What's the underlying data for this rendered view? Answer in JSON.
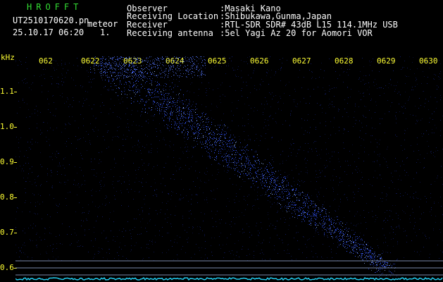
{
  "header": {
    "brand": "HROFFT",
    "filename": "UT2510170620.pn",
    "tag": "meteor",
    "datetime": "25.10.17 06:20",
    "count": "1."
  },
  "station": {
    "observer_label": "Observer",
    "observer_value": ":Masaki Kano",
    "location_label": "Receiving Location",
    "location_value": ":Shibukawa,Gunma,Japan",
    "receiver_label": "Receiver",
    "receiver_value": ":RTL-SDR SDR# 43dB L15 114.1MHz USB",
    "antenna_label": "Receiving antenna",
    "antenna_value": ":5el Yagi Az 20 for Aomori VOR"
  },
  "axis": {
    "unit": "kHz",
    "y_ticks": [
      "1.1",
      "1.0",
      "0.9",
      "0.8",
      "0.7",
      "0.6"
    ],
    "x_ticks": [
      "062",
      "0622",
      "0623",
      "0624",
      "0625",
      "0626",
      "0627",
      "0628",
      "0629",
      "0630"
    ]
  },
  "colors": {
    "background": "#000000",
    "axis_text": "#ffff33",
    "brand_text": "#33dd33",
    "signal": "#3355ff",
    "noise_floor": "#22ccee"
  }
}
